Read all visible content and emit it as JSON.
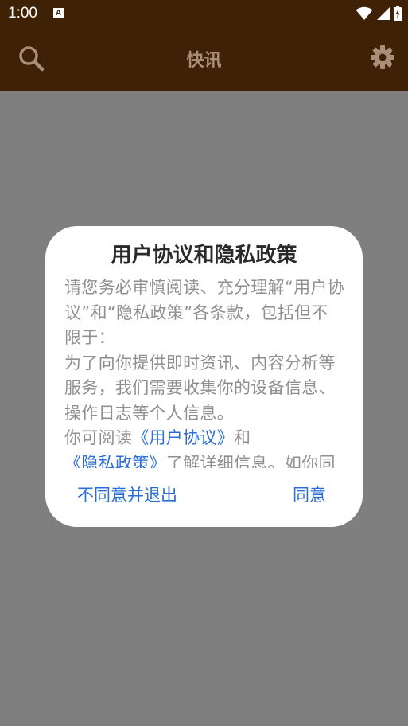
{
  "status_bar": {
    "time": "1:00",
    "notification_icon": "A"
  },
  "toolbar": {
    "title": "快讯",
    "search_icon": "search-icon",
    "settings_icon": "gear-icon"
  },
  "dialog": {
    "title": "用户协议和隐私政策",
    "paragraph1": "请您务必审慎阅读、充分理解“用户协议”和“隐私政策”各条款，包括但不限于：",
    "paragraph2": "为了向你提供即时资讯、内容分析等服务，我们需要收集你的设备信息、操作日志等个人信息。",
    "paragraph3_prefix": "你可阅读",
    "user_agreement_link": "《用户协议》",
    "paragraph3_and": "和",
    "privacy_policy_link": "《隐私政策》",
    "paragraph3_suffix": "了解详细信息。如你同意，请点",
    "decline_button": "不同意并退出",
    "agree_button": "同意"
  },
  "colors": {
    "bar": "#3f2106",
    "title_text": "#a98f79",
    "link": "#2b6fd6",
    "body_text": "#8f8f8f"
  }
}
